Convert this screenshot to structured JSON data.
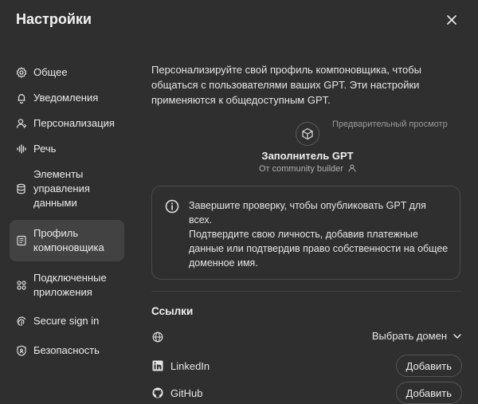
{
  "header": {
    "title": "Настройки"
  },
  "sidebar": {
    "items": [
      {
        "label": "Общее"
      },
      {
        "label": "Уведомления"
      },
      {
        "label": "Персонализация"
      },
      {
        "label": "Речь"
      },
      {
        "label": "Элементы управления данными"
      },
      {
        "label": "Профиль компоновщика"
      },
      {
        "label": "Подключенные приложения"
      },
      {
        "label": "Secure sign in"
      },
      {
        "label": "Безопасность"
      }
    ]
  },
  "main": {
    "intro": "Персонализируйте свой профиль компоновщика, чтобы общаться с пользователями ваших GPT. Эти настройки применяются к общедоступным GPT.",
    "preview_label": "Предварительный просмотр",
    "gpt_name": "Заполнитель GPT",
    "gpt_by": "От community builder",
    "notice_line1": "Завершите проверку, чтобы опубликовать GPT для всех.",
    "notice_line2": "Подтвердите свою личность, добавив платежные данные или подтвердив право собственности на общее доменное имя.",
    "links_title": "Ссылки",
    "domain_select": "Выбрать домен",
    "linkedin_label": "LinkedIn",
    "github_label": "GitHub",
    "add_label": "Добавить"
  },
  "icons": [
    "gear-icon",
    "bell-icon",
    "person-icon",
    "waveform-icon",
    "database-icon",
    "id-card-icon",
    "apps-icon",
    "fingerprint-icon",
    "shield-icon",
    "globe-icon",
    "linkedin-icon",
    "github-icon",
    "close-icon",
    "info-icon",
    "cube-icon",
    "chevron-down-icon"
  ]
}
